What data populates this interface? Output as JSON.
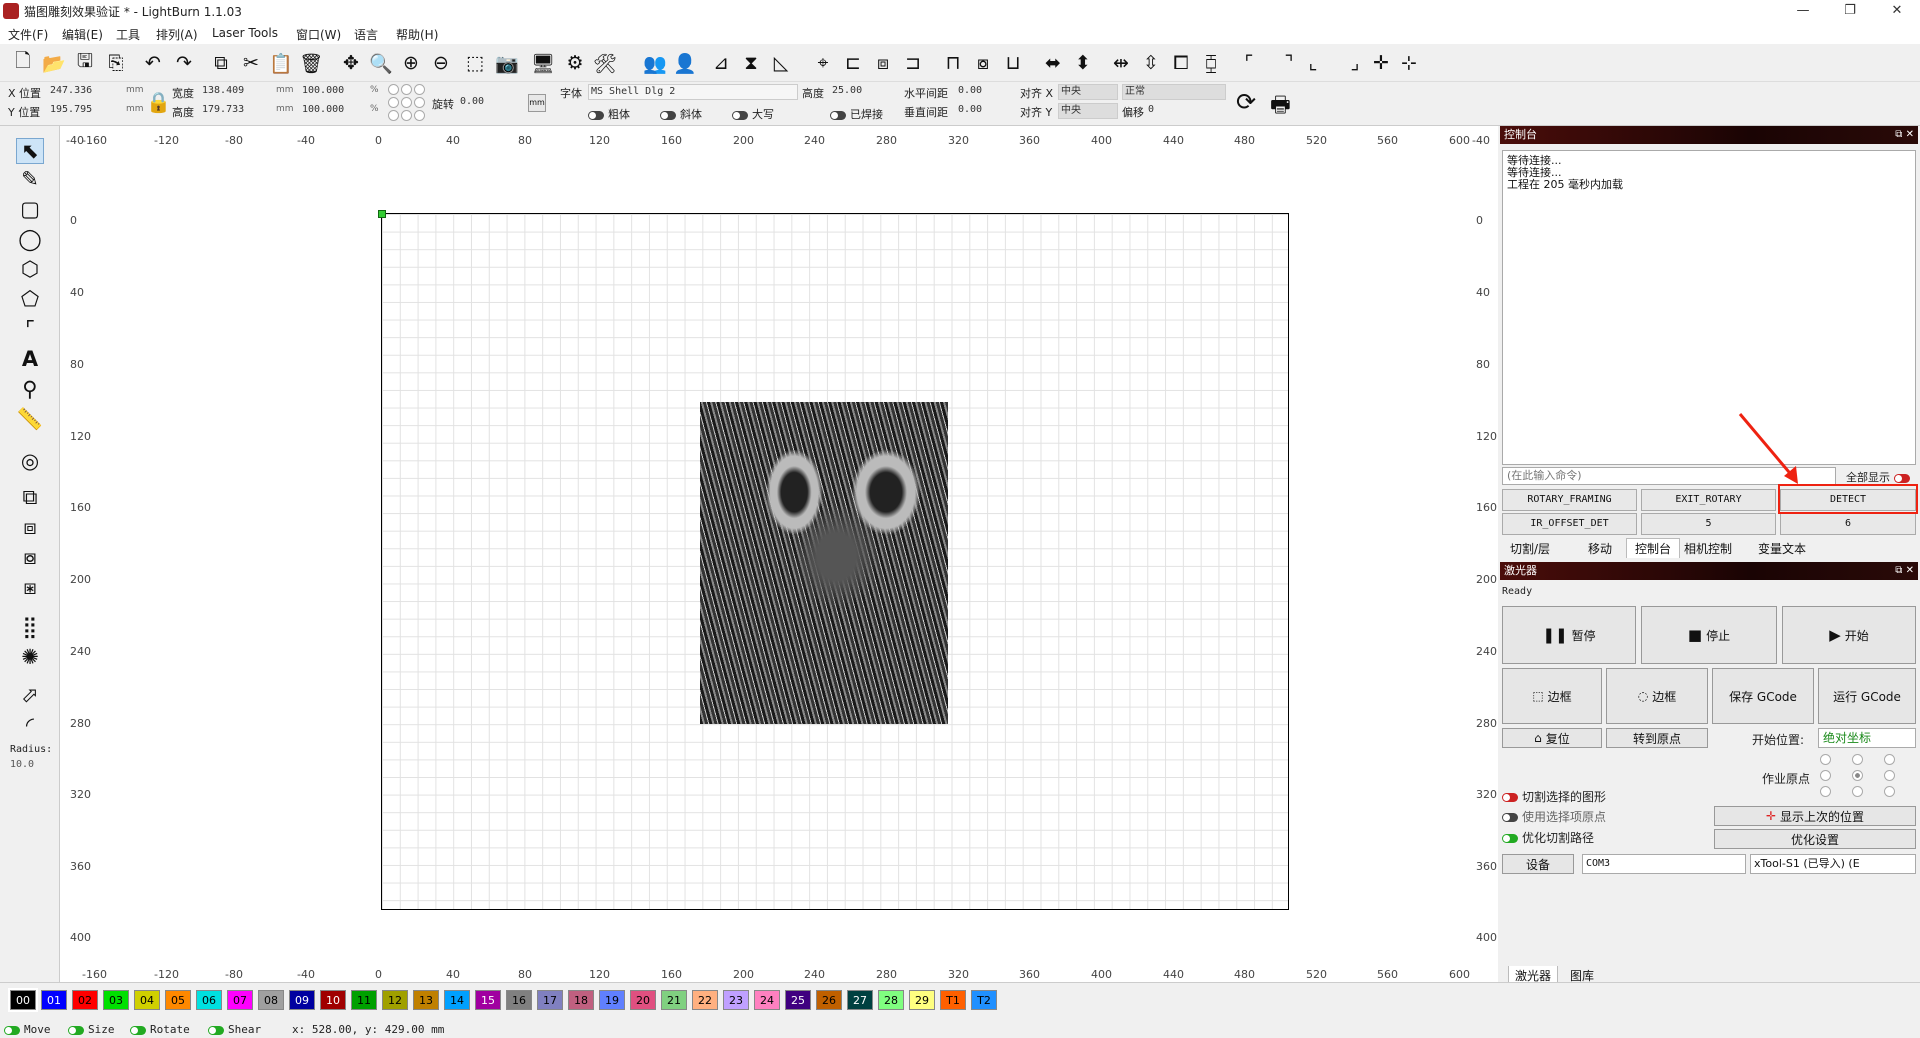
{
  "window": {
    "title": "猫图雕刻效果验证 * - LightBurn 1.1.03",
    "min": "—",
    "max": "❐",
    "close": "✕"
  },
  "menus": [
    "文件(F)",
    "编辑(E)",
    "工具",
    "排列(A)",
    "Laser Tools",
    "窗口(W)",
    "语言",
    "帮助(H)"
  ],
  "toolbar2": {
    "x_label": "X 位置",
    "x_value": "247.336",
    "y_label": "Y 位置",
    "y_value": "195.795",
    "unit": "mm",
    "w_label": "宽度",
    "w_value": "138.409",
    "h_label": "高度",
    "h_value": "179.733",
    "pct_w": "100.000",
    "pct_h": "100.000",
    "pct": "%",
    "rot_label": "旋转",
    "rot_value": "0.00",
    "mm_btn": "mm",
    "font_label": "字体",
    "font_value": "MS Shell Dlg 2",
    "height_label": "高度",
    "height_value": "25.00",
    "hspace_label": "水平间距",
    "hspace_value": "0.00",
    "vspace_label": "垂直间距",
    "vspace_value": "0.00",
    "alignx_label": "对齐 X",
    "alignx_value": "中央",
    "aligny_label": "对齐 Y",
    "aligny_value": "中央",
    "style_value": "正常",
    "offset_label": "偏移",
    "offset_value": "0",
    "bold": "粗体",
    "italic": "斜体",
    "caps": "大写",
    "welded": "已焊接"
  },
  "ruler": {
    "top": [
      "-160",
      "-120",
      "-80",
      "-40",
      "0",
      "40",
      "80",
      "120",
      "160",
      "200",
      "240",
      "280",
      "320",
      "360",
      "400",
      "440",
      "480",
      "520",
      "560",
      "600"
    ],
    "top_edge": "-40",
    "left": [
      "0",
      "40",
      "80",
      "120",
      "160",
      "200",
      "240",
      "280",
      "320",
      "360",
      "400"
    ]
  },
  "left_tools": {
    "radius_label": "Radius:",
    "radius_value": "10.0"
  },
  "console": {
    "title": "控制台",
    "lines": [
      "等待连接...",
      "等待连接...",
      "工程在 205 毫秒内加载"
    ],
    "placeholder": "(在此输入命令)",
    "show_all": "全部显示",
    "macros": [
      "ROTARY_FRAMING",
      "EXIT_ROTARY",
      "DETECT",
      "IR_OFFSET_DET",
      "5",
      "6"
    ],
    "tabs": [
      "切割/层",
      "移动",
      "控制台",
      "相机控制",
      "变量文本"
    ]
  },
  "laser": {
    "title": "激光器",
    "status": "Ready",
    "pause": "暂停",
    "stop": "停止",
    "start": "开始",
    "frame1": "边框",
    "frame2": "边框",
    "save_gcode": "保存 GCode",
    "run_gcode": "运行 GCode",
    "home": "复位",
    "goto_origin": "转到原点",
    "start_from_label": "开始位置:",
    "start_from_value": "绝对坐标",
    "job_origin_label": "作业原点",
    "cut_selected": "切割选择的图形",
    "use_selection_origin": "使用选择项原点",
    "optimize_path": "优化切割路径",
    "show_last_pos": "显示上次的位置",
    "optimize_settings": "优化设置",
    "devices": "设备",
    "port": "COM3",
    "device_name": "xTool-S1 (已导入) (E",
    "bottom_tabs": [
      "激光器",
      "图库"
    ]
  },
  "palette": [
    {
      "l": "00",
      "c": "#000000",
      "t": "#ffffff"
    },
    {
      "l": "01",
      "c": "#0000ff",
      "t": "#ffffff"
    },
    {
      "l": "02",
      "c": "#ff0000",
      "t": "#000000"
    },
    {
      "l": "03",
      "c": "#00e000",
      "t": "#000000"
    },
    {
      "l": "04",
      "c": "#d0d000",
      "t": "#000000"
    },
    {
      "l": "05",
      "c": "#ff8800",
      "t": "#000000"
    },
    {
      "l": "06",
      "c": "#00e0e0",
      "t": "#000000"
    },
    {
      "l": "07",
      "c": "#ff00ff",
      "t": "#000000"
    },
    {
      "l": "08",
      "c": "#a0a0a0",
      "t": "#000000"
    },
    {
      "l": "09",
      "c": "#0000a0",
      "t": "#ffffff"
    },
    {
      "l": "10",
      "c": "#a00000",
      "t": "#ffffff"
    },
    {
      "l": "11",
      "c": "#00a000",
      "t": "#000000"
    },
    {
      "l": "12",
      "c": "#a0a000",
      "t": "#000000"
    },
    {
      "l": "13",
      "c": "#c08000",
      "t": "#000000"
    },
    {
      "l": "14",
      "c": "#00a0ff",
      "t": "#000000"
    },
    {
      "l": "15",
      "c": "#a000a0",
      "t": "#ffffff"
    },
    {
      "l": "16",
      "c": "#808080",
      "t": "#000000"
    },
    {
      "l": "17",
      "c": "#8080c0",
      "t": "#000000"
    },
    {
      "l": "18",
      "c": "#c06080",
      "t": "#000000"
    },
    {
      "l": "19",
      "c": "#6080ff",
      "t": "#000000"
    },
    {
      "l": "20",
      "c": "#e05080",
      "t": "#000000"
    },
    {
      "l": "21",
      "c": "#80d080",
      "t": "#000000"
    },
    {
      "l": "22",
      "c": "#ffb080",
      "t": "#000000"
    },
    {
      "l": "23",
      "c": "#c0a0ff",
      "t": "#000000"
    },
    {
      "l": "24",
      "c": "#ff80c0",
      "t": "#000000"
    },
    {
      "l": "25",
      "c": "#400080",
      "t": "#ffffff"
    },
    {
      "l": "26",
      "c": "#c06000",
      "t": "#000000"
    },
    {
      "l": "27",
      "c": "#004040",
      "t": "#ffffff"
    },
    {
      "l": "28",
      "c": "#80ff80",
      "t": "#000000"
    },
    {
      "l": "29",
      "c": "#ffff80",
      "t": "#000000"
    },
    {
      "l": "T1",
      "c": "#ff6000",
      "t": "#000000"
    },
    {
      "l": "T2",
      "c": "#2090ff",
      "t": "#000000"
    }
  ],
  "status": {
    "move": "Move",
    "size": "Size",
    "rotate": "Rotate",
    "shear": "Shear",
    "coords": "x: 528.00, y: 429.00 mm"
  }
}
